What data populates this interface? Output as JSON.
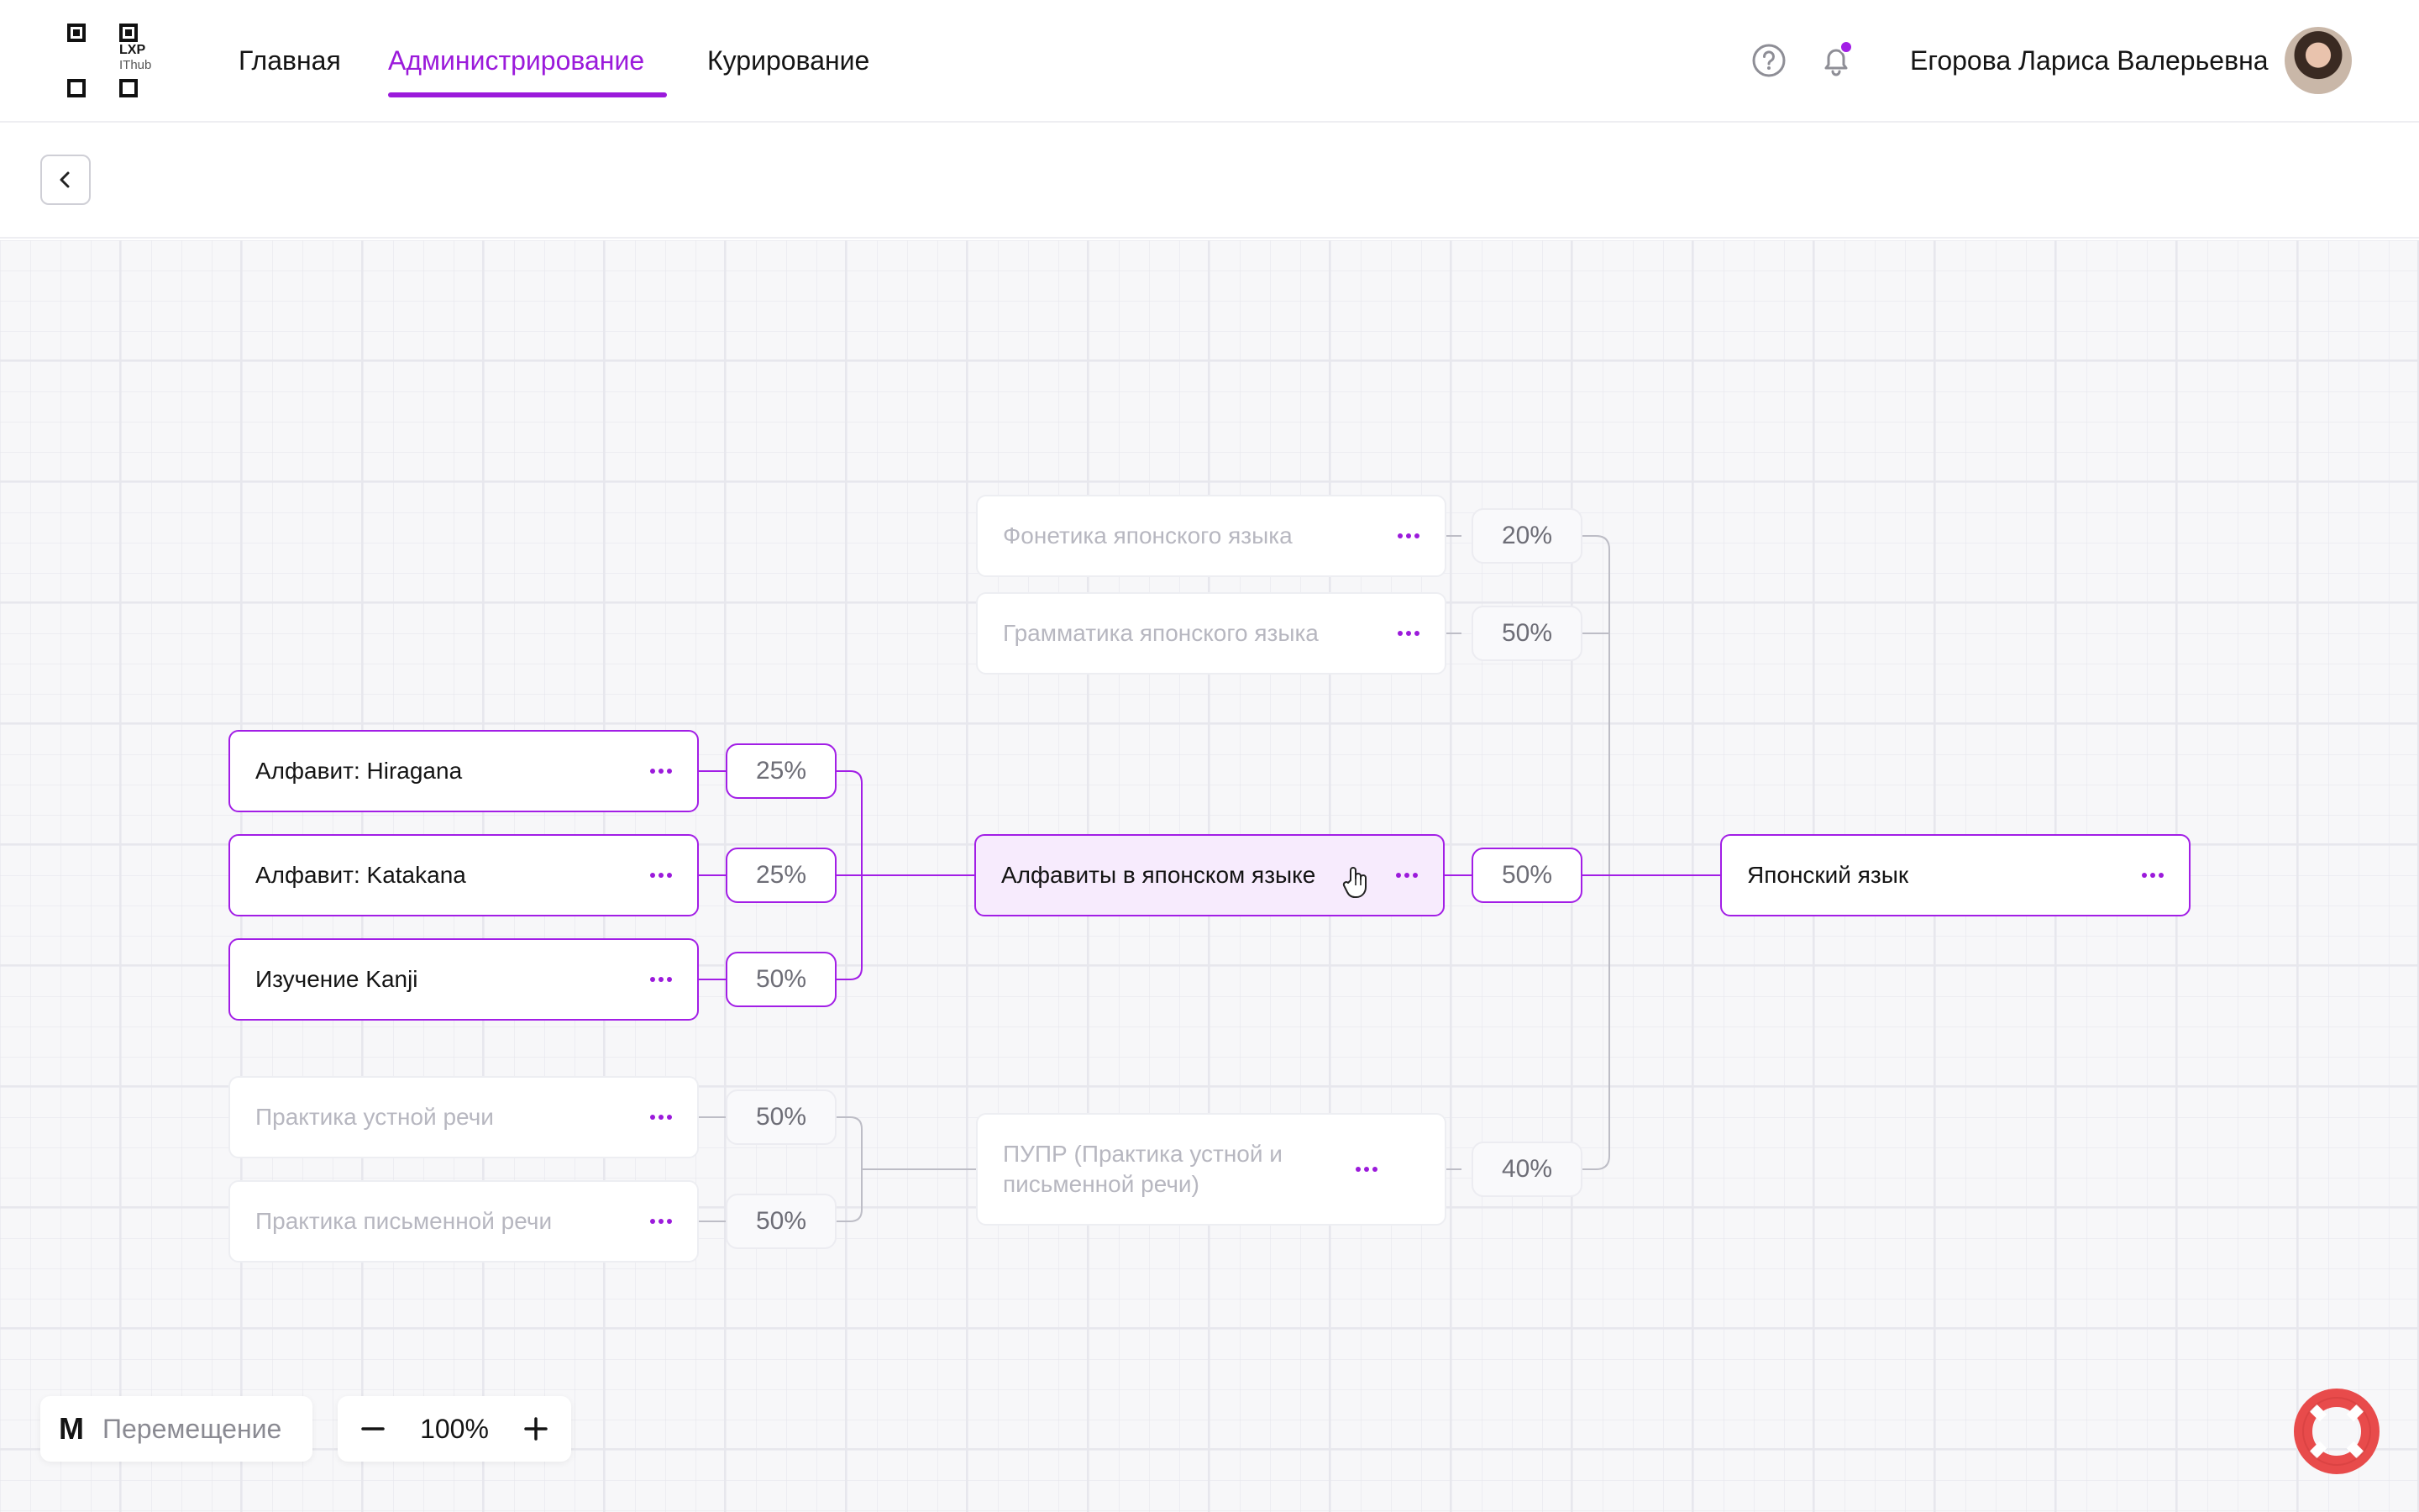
{
  "header": {
    "logo": {
      "line1": "LXP",
      "line2": "IThub"
    },
    "nav": [
      {
        "label": "Главная",
        "active": false
      },
      {
        "label": "Администрирование",
        "active": true
      },
      {
        "label": "Курирование",
        "active": false
      }
    ],
    "icons": {
      "help": "help-circle-icon",
      "notifications": "bell-icon"
    },
    "user": {
      "name": "Егорова Лариса Валерьевна"
    }
  },
  "toolbar": {
    "back_icon": "chevron-left-icon"
  },
  "graph": {
    "nodes": {
      "phonetics": {
        "label": "Фонетика японского языка",
        "state": "dim"
      },
      "grammar": {
        "label": "Грамматика японского языка",
        "state": "dim"
      },
      "hiragana": {
        "label": "Алфавит: Hiragana",
        "state": "active"
      },
      "katakana": {
        "label": "Алфавит: Katakana",
        "state": "active"
      },
      "kanji": {
        "label": "Изучение Kanji",
        "state": "active"
      },
      "alphabets": {
        "label": "Алфавиты в японском языке",
        "state": "selected"
      },
      "japanese": {
        "label": "Японский язык",
        "state": "active"
      },
      "speaking": {
        "label": "Практика устной речи",
        "state": "dim"
      },
      "writing": {
        "label": "Практика письменной речи",
        "state": "dim"
      },
      "pupr": {
        "label": "ПУПР (Практика устной и письменной речи)",
        "state": "dim"
      }
    },
    "weights": {
      "phonetics": "20%",
      "grammar": "50%",
      "hiragana": "25%",
      "katakana": "25%",
      "kanji": "50%",
      "alphabets": "50%",
      "speaking": "50%",
      "writing": "50%",
      "pupr": "40%"
    },
    "colors": {
      "accent": "#a21ee6",
      "line": "#bdbdc6"
    }
  },
  "controls": {
    "mode": {
      "key": "M",
      "label": "Перемещение"
    },
    "zoom": {
      "value": "100%"
    },
    "support_icon": "lifebuoy-icon"
  }
}
